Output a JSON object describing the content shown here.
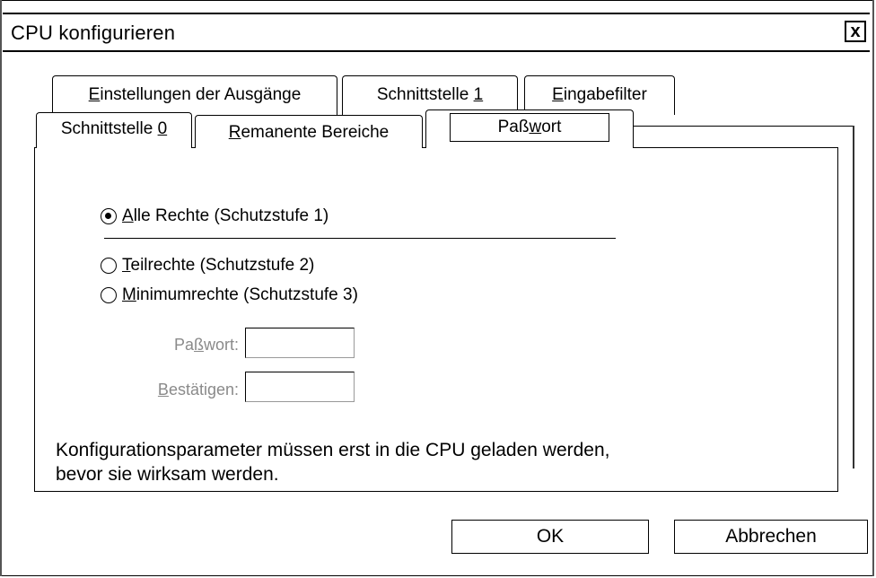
{
  "window": {
    "title": "CPU konfigurieren",
    "close_glyph": "x"
  },
  "tabs_row1": [
    {
      "label": "Einstellungen der Ausgänge",
      "accel": "E",
      "rest": "instellungen der Ausgänge"
    },
    {
      "label": "Schnittstelle 1",
      "pre": "Schnittstelle ",
      "accel": "1"
    },
    {
      "label": "Eingabefilter",
      "accel": "E",
      "rest": "ingabefilter"
    }
  ],
  "tabs_row2": [
    {
      "label": "Schnittstelle 0",
      "pre": "Schnittstelle ",
      "accel": "0"
    },
    {
      "label": "Remanente Bereiche",
      "accel": "R",
      "rest": "emanente Bereiche"
    },
    {
      "label": "Paßwort",
      "pre": "Paß",
      "accel": "w",
      "rest": "ort",
      "active": true
    }
  ],
  "protection": {
    "options": [
      {
        "label": "Alle Rechte (Schutzstufe 1)",
        "accel": "A",
        "rest": "lle Rechte (Schutzstufe 1)",
        "selected": true
      },
      {
        "label": "Teilrechte (Schutzstufe 2)",
        "accel": "T",
        "rest": "eilrechte (Schutzstufe 2)",
        "selected": false
      },
      {
        "label": "Minimumrechte (Schutzstufe 3)",
        "accel": "M",
        "rest": "inimumrechte (Schutzstufe 3)",
        "selected": false
      }
    ]
  },
  "fields": {
    "password": {
      "pre": "Pa",
      "accel": "ß",
      "rest": "wort:",
      "value": ""
    },
    "confirm": {
      "accel": "B",
      "rest": "estätigen:",
      "value": ""
    }
  },
  "note": {
    "line1": "Konfigurationsparameter müssen erst in die CPU geladen werden,",
    "line2": "bevor sie wirksam werden."
  },
  "buttons": {
    "ok": "OK",
    "cancel": "Abbrechen"
  }
}
